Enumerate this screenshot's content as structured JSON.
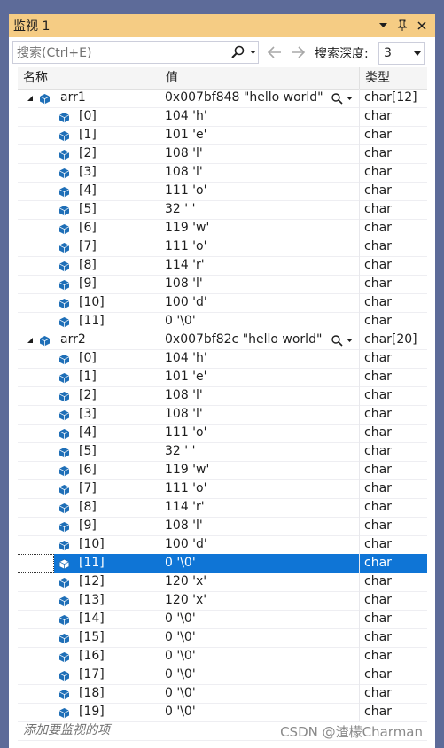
{
  "window": {
    "title": "监视 1"
  },
  "toolbar": {
    "search_placeholder": "搜索(Ctrl+E)",
    "depth_label": "搜索深度:",
    "depth_value": "3"
  },
  "columns": {
    "name": "名称",
    "value": "值",
    "type": "类型"
  },
  "rows": [
    {
      "name": "arr1",
      "value": "0x007bf848 \"hello world\"",
      "type": "char[12]",
      "level": 0,
      "expanded": true
    },
    {
      "name": "[0]",
      "value": "104 'h'",
      "type": "char",
      "level": 1
    },
    {
      "name": "[1]",
      "value": "101 'e'",
      "type": "char",
      "level": 1
    },
    {
      "name": "[2]",
      "value": "108 'l'",
      "type": "char",
      "level": 1
    },
    {
      "name": "[3]",
      "value": "108 'l'",
      "type": "char",
      "level": 1
    },
    {
      "name": "[4]",
      "value": "111 'o'",
      "type": "char",
      "level": 1
    },
    {
      "name": "[5]",
      "value": "32 ' '",
      "type": "char",
      "level": 1
    },
    {
      "name": "[6]",
      "value": "119 'w'",
      "type": "char",
      "level": 1
    },
    {
      "name": "[7]",
      "value": "111 'o'",
      "type": "char",
      "level": 1
    },
    {
      "name": "[8]",
      "value": "114 'r'",
      "type": "char",
      "level": 1
    },
    {
      "name": "[9]",
      "value": "108 'l'",
      "type": "char",
      "level": 1
    },
    {
      "name": "[10]",
      "value": "100 'd'",
      "type": "char",
      "level": 1
    },
    {
      "name": "[11]",
      "value": "0 '\\0'",
      "type": "char",
      "level": 1
    },
    {
      "name": "arr2",
      "value": "0x007bf82c \"hello world\"",
      "type": "char[20]",
      "level": 0,
      "expanded": true
    },
    {
      "name": "[0]",
      "value": "104 'h'",
      "type": "char",
      "level": 1
    },
    {
      "name": "[1]",
      "value": "101 'e'",
      "type": "char",
      "level": 1
    },
    {
      "name": "[2]",
      "value": "108 'l'",
      "type": "char",
      "level": 1
    },
    {
      "name": "[3]",
      "value": "108 'l'",
      "type": "char",
      "level": 1
    },
    {
      "name": "[4]",
      "value": "111 'o'",
      "type": "char",
      "level": 1
    },
    {
      "name": "[5]",
      "value": "32 ' '",
      "type": "char",
      "level": 1
    },
    {
      "name": "[6]",
      "value": "119 'w'",
      "type": "char",
      "level": 1
    },
    {
      "name": "[7]",
      "value": "111 'o'",
      "type": "char",
      "level": 1
    },
    {
      "name": "[8]",
      "value": "114 'r'",
      "type": "char",
      "level": 1
    },
    {
      "name": "[9]",
      "value": "108 'l'",
      "type": "char",
      "level": 1
    },
    {
      "name": "[10]",
      "value": "100 'd'",
      "type": "char",
      "level": 1
    },
    {
      "name": "[11]",
      "value": "0 '\\0'",
      "type": "char",
      "level": 1,
      "selected": true
    },
    {
      "name": "[12]",
      "value": "120 'x'",
      "type": "char",
      "level": 1
    },
    {
      "name": "[13]",
      "value": "120 'x'",
      "type": "char",
      "level": 1
    },
    {
      "name": "[14]",
      "value": "0 '\\0'",
      "type": "char",
      "level": 1
    },
    {
      "name": "[15]",
      "value": "0 '\\0'",
      "type": "char",
      "level": 1
    },
    {
      "name": "[16]",
      "value": "0 '\\0'",
      "type": "char",
      "level": 1
    },
    {
      "name": "[17]",
      "value": "0 '\\0'",
      "type": "char",
      "level": 1
    },
    {
      "name": "[18]",
      "value": "0 '\\0'",
      "type": "char",
      "level": 1
    },
    {
      "name": "[19]",
      "value": "0 '\\0'",
      "type": "char",
      "level": 1
    }
  ],
  "add_item_placeholder": "添加要监视的项",
  "watermark": "CSDN @渣檬Charman",
  "colors": {
    "title_bar": "#f5cc84",
    "frame": "#5d6b99",
    "selection": "#0f75d6",
    "cube": "#1f6fb7"
  }
}
